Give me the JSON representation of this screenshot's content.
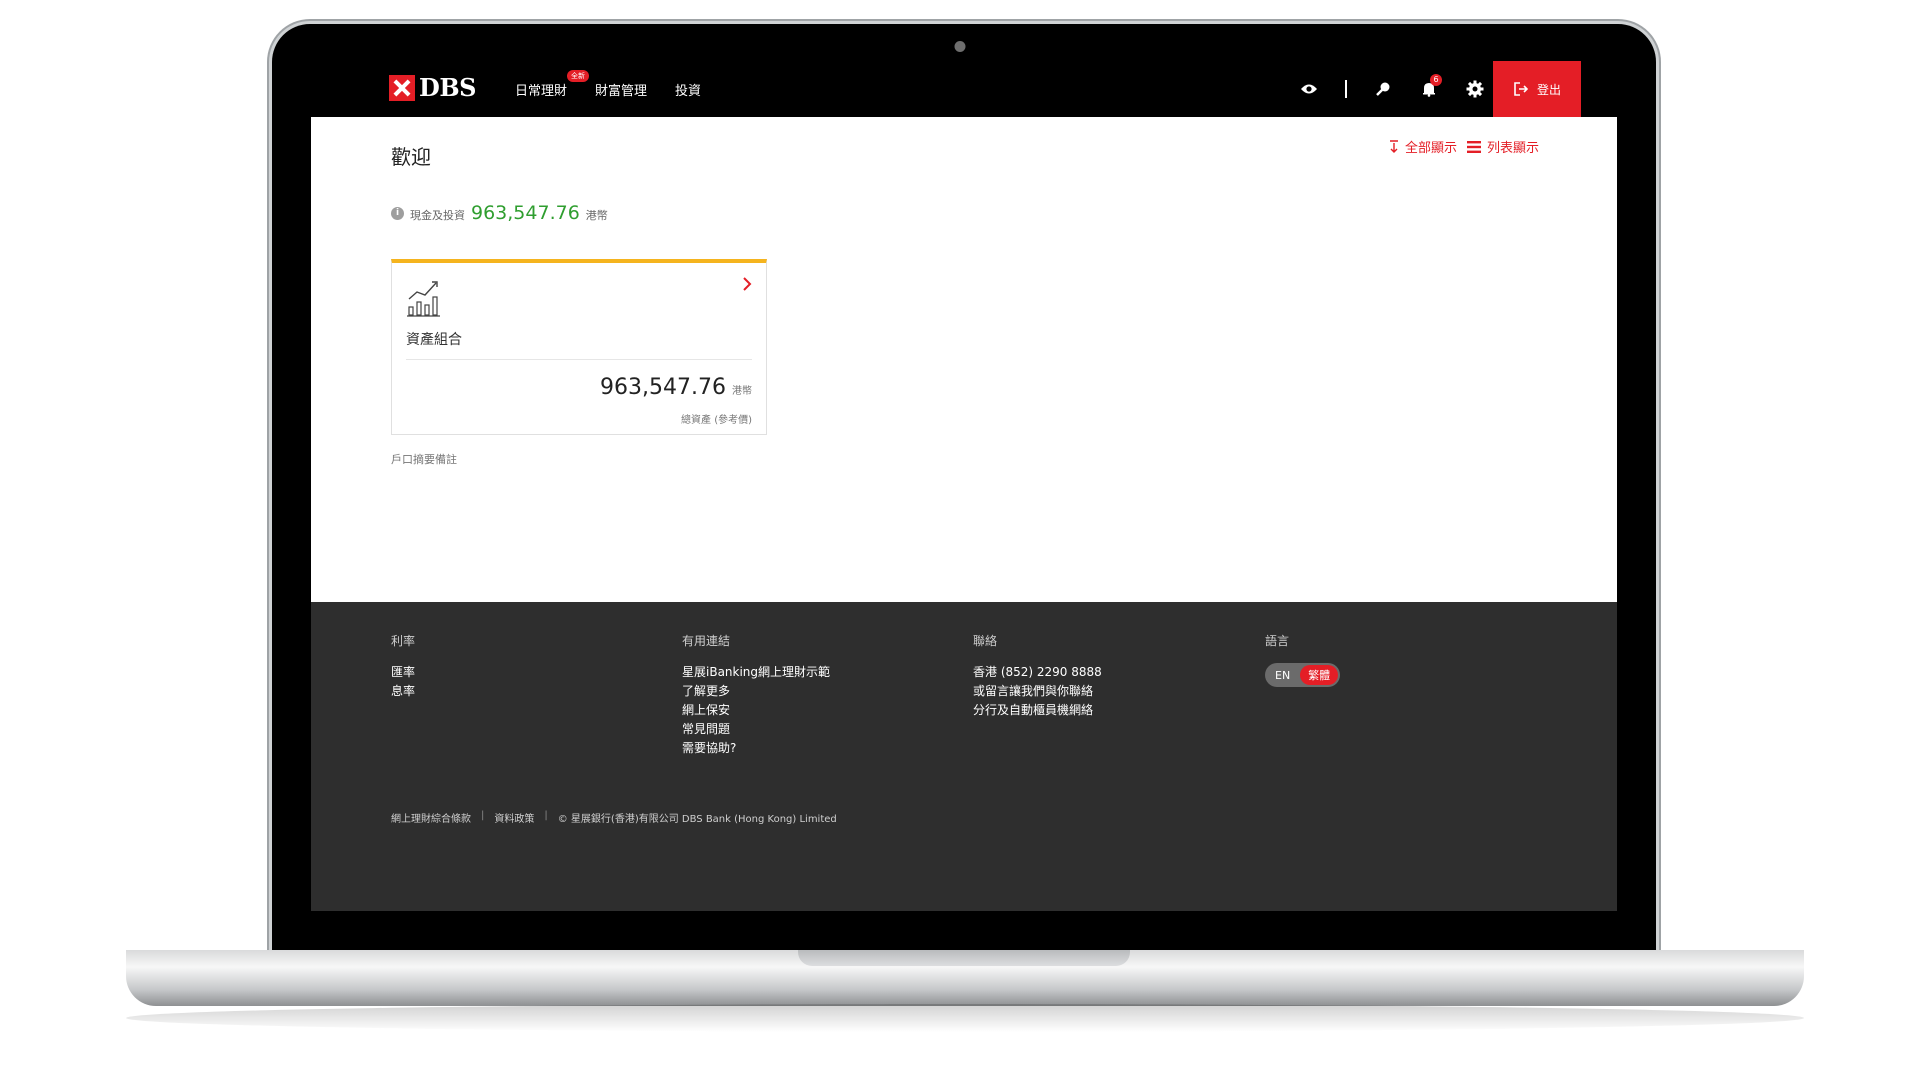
{
  "header": {
    "logo_text": "DBS",
    "nav": [
      {
        "label": "日常理財",
        "badge": "全新"
      },
      {
        "label": "財富管理"
      },
      {
        "label": "投資"
      }
    ],
    "notification_count": "6",
    "logout_label": "登出"
  },
  "main": {
    "welcome": "歡迎",
    "view_all_label": "全部顯示",
    "list_view_label": "列表顯示",
    "summary": {
      "info_glyph": "i",
      "label": "現金及投資",
      "value": "963,547.76",
      "currency": "港幣"
    },
    "card": {
      "title": "資產組合",
      "amount": "963,547.76",
      "currency": "港幣",
      "sub_label": "總資產 (參考價)"
    },
    "account_note": "戶口摘要備註"
  },
  "footer": {
    "rates": {
      "title": "利率",
      "links": [
        "匯率",
        "息率"
      ]
    },
    "useful_links": {
      "title": "有用連結",
      "links": [
        "星展iBanking網上理財示範",
        "了解更多",
        "網上保安",
        "常見問題",
        "需要協助?"
      ]
    },
    "contact": {
      "title": "聯絡",
      "links": [
        "香港 (852) 2290 8888",
        "或留言讓我們與你聯絡",
        "分行及自動櫃員機網絡"
      ]
    },
    "language": {
      "title": "語言",
      "options": [
        "EN",
        "繁體"
      ],
      "selected": "繁體"
    },
    "legal": {
      "terms": "網上理財綜合條款",
      "privacy": "資料政策",
      "copyright": "© 星展銀行(香港)有限公司 DBS Bank (Hong Kong) Limited"
    }
  },
  "colors": {
    "brand_red": "#e41e26",
    "positive_green": "#2f9e2f",
    "card_accent": "#f5b41e",
    "footer_bg": "#2e2e2e"
  }
}
